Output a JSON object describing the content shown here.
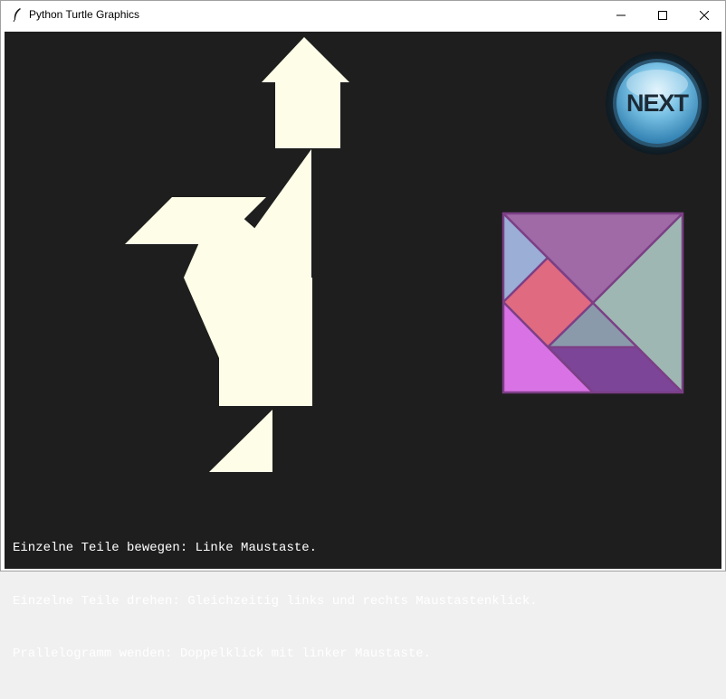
{
  "window": {
    "title": "Python Turtle Graphics",
    "minimize_icon": "minimize-icon",
    "maximize_icon": "maximize-icon",
    "close_icon": "close-icon"
  },
  "canvas": {
    "background": "#1e1e1e",
    "piece_color": "#fefee8",
    "next_button": {
      "label": "NEXT",
      "icon": "next-button-icon"
    },
    "instructions": [
      "Einzelne Teile bewegen: Linke Maustaste.",
      "Einzelne Teile drehen: Gleichzeitig links und rechts Maustastenklick.",
      "Prallelogramm wenden: Doppelklick mit linker Maustaste."
    ],
    "solution_preview": {
      "border_color": "#7c3f86",
      "piece_colors": {
        "top_large_triangle": "#9f6aa6",
        "right_large_triangle": "#9eb7b2",
        "left_small_triangle": "#9aaed6",
        "square": "#e06a80",
        "middle_small_triangle": "#8a9aaa",
        "bottom_left_medium_triangle": "#d972e4",
        "parallelogram": "#7c4598"
      }
    }
  }
}
